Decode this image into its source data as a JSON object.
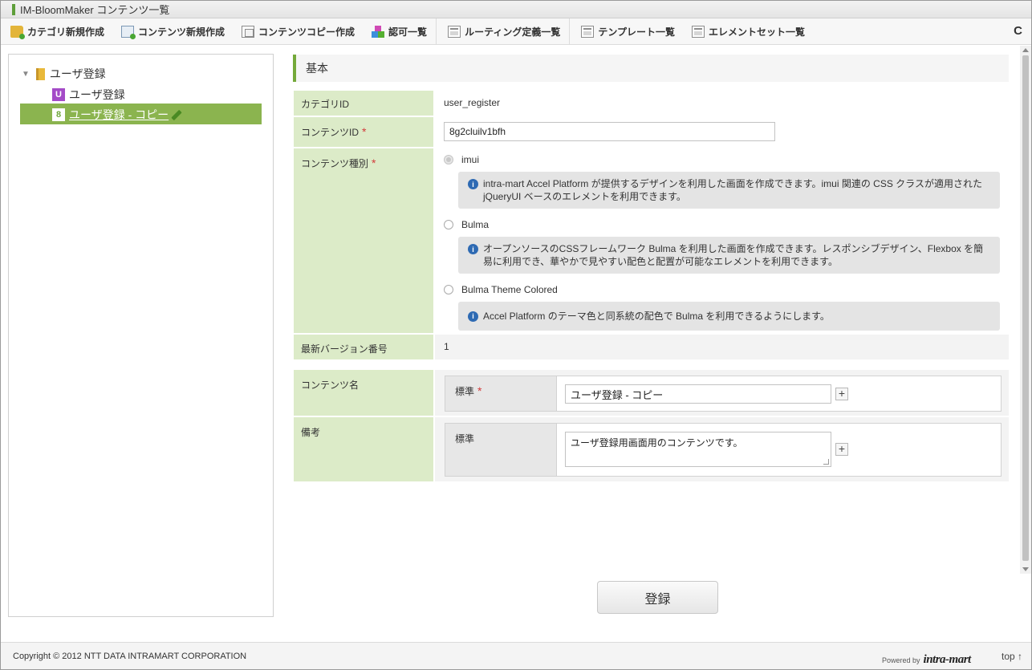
{
  "window": {
    "title": "IM-BloomMaker コンテンツ一覧"
  },
  "toolbar": {
    "items": [
      {
        "label": "カテゴリ新規作成",
        "icon": "folder-add-icon"
      },
      {
        "label": "コンテンツ新規作成",
        "icon": "content-add-icon"
      },
      {
        "label": "コンテンツコピー作成",
        "icon": "copy-icon"
      },
      {
        "label": "認可一覧",
        "icon": "permission-icon"
      },
      {
        "label": "ルーティング定義一覧",
        "icon": "window-icon"
      },
      {
        "label": "テンプレート一覧",
        "icon": "window-icon"
      },
      {
        "label": "エレメントセット一覧",
        "icon": "window-icon"
      }
    ],
    "refresh_glyph": "C"
  },
  "tree": {
    "toggle": "▼",
    "root": "ユーザ登録",
    "children": [
      {
        "badge": "U",
        "label": "ユーザ登録"
      },
      {
        "badge": "8",
        "label": "ユーザ登録 - コピー"
      }
    ]
  },
  "section": {
    "title": "基本"
  },
  "form": {
    "category_id": {
      "label": "カテゴリID",
      "value": "user_register"
    },
    "content_id": {
      "label": "コンテンツID",
      "required": "*",
      "value": "8g2cluilv1bfh"
    },
    "content_type": {
      "label": "コンテンツ種別",
      "required": "*",
      "options": [
        {
          "label": "imui",
          "info": "intra-mart Accel Platform が提供するデザインを利用した画面を作成できます。imui 関連の CSS クラスが適用された jQueryUI ベースのエレメントを利用できます。"
        },
        {
          "label": "Bulma",
          "info": "オープンソースのCSSフレームワーク Bulma を利用した画面を作成できます。レスポンシブデザイン、Flexbox を簡易に利用でき、華やかで見やすい配色と配置が可能なエレメントを利用できます。"
        },
        {
          "label": "Bulma Theme Colored",
          "info": "Accel Platform のテーマ色と同系統の配色で Bulma を利用できるようにします。"
        }
      ]
    },
    "latest_version": {
      "label": "最新バージョン番号",
      "value": "1"
    },
    "content_name": {
      "label": "コンテンツ名",
      "sub_label": "標準",
      "required": "*",
      "value": "ユーザ登録 - コピー"
    },
    "remarks": {
      "label": "備考",
      "sub_label": "標準",
      "value": "ユーザ登録用画面用のコンテンツです。"
    },
    "plus": "+"
  },
  "submit": {
    "label": "登録"
  },
  "footer": {
    "copyright": "Copyright © 2012 NTT DATA INTRAMART CORPORATION",
    "powered_by": "Powered by",
    "logo": "intra-mart",
    "top_link": "top ↑"
  },
  "colors": {
    "accent": "#74a93a",
    "label_bg": "#dcebc8",
    "selected": "#8bb44f"
  }
}
